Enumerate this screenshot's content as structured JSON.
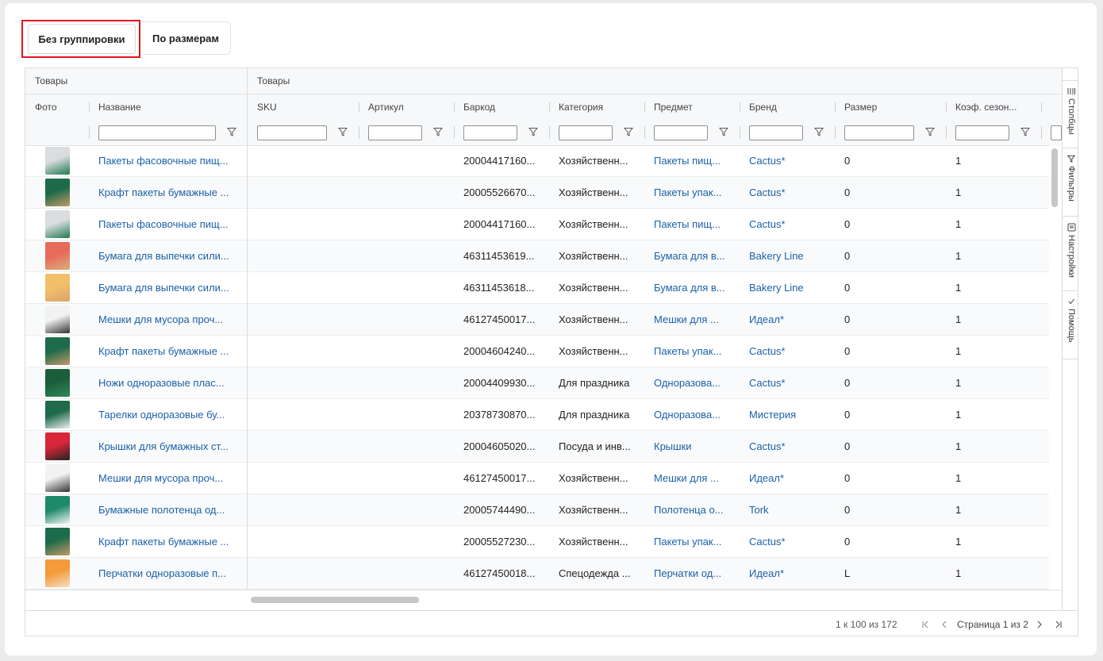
{
  "tabs": [
    {
      "label": "Без группировки"
    },
    {
      "label": "По размерам"
    }
  ],
  "header_groups": [
    {
      "label": "Товары"
    },
    {
      "label": "Товары"
    }
  ],
  "columns": [
    {
      "label": "Фото"
    },
    {
      "label": "Название"
    },
    {
      "label": "SKU"
    },
    {
      "label": "Артикул"
    },
    {
      "label": "Баркод"
    },
    {
      "label": "Категория"
    },
    {
      "label": "Предмет"
    },
    {
      "label": "Бренд"
    },
    {
      "label": "Размер"
    },
    {
      "label": "Коэф. сезон..."
    }
  ],
  "rows": [
    {
      "name": "Пакеты фасовочные пищ...",
      "barcode": "20004417160...",
      "category": "Хозяйственн...",
      "subject": "Пакеты пищ...",
      "brand": "Cactus*",
      "size": "0",
      "coef": "1",
      "thumb_colors": [
        "#d9dde0",
        "#1f7a4e"
      ]
    },
    {
      "name": "Крафт пакеты бумажные ...",
      "barcode": "20005526670...",
      "category": "Хозяйственн...",
      "subject": "Пакеты упак...",
      "brand": "Cactus*",
      "size": "0",
      "coef": "1",
      "thumb_colors": [
        "#1d6b4a",
        "#c39a6a"
      ]
    },
    {
      "name": "Пакеты фасовочные пищ...",
      "barcode": "20004417160...",
      "category": "Хозяйственн...",
      "subject": "Пакеты пищ...",
      "brand": "Cactus*",
      "size": "0",
      "coef": "1",
      "thumb_colors": [
        "#d9dde0",
        "#1f7a4e"
      ]
    },
    {
      "name": "Бумага для выпечки сили...",
      "barcode": "46311453619...",
      "category": "Хозяйственн...",
      "subject": "Бумага для в...",
      "brand": "Bakery Line",
      "size": "0",
      "coef": "1",
      "thumb_colors": [
        "#e86a5a",
        "#d9b07a"
      ]
    },
    {
      "name": "Бумага для выпечки сили...",
      "barcode": "46311453618...",
      "category": "Хозяйственн...",
      "subject": "Бумага для в...",
      "brand": "Bakery Line",
      "size": "0",
      "coef": "1",
      "thumb_colors": [
        "#f3c06a",
        "#d9a36a"
      ]
    },
    {
      "name": "Мешки для мусора проч...",
      "barcode": "46127450017...",
      "category": "Хозяйственн...",
      "subject": "Мешки для ...",
      "brand": "Идеал*",
      "size": "0",
      "coef": "1",
      "thumb_colors": [
        "#f2f2f2",
        "#333333"
      ]
    },
    {
      "name": "Крафт пакеты бумажные ...",
      "barcode": "20004604240...",
      "category": "Хозяйственн...",
      "subject": "Пакеты упак...",
      "brand": "Cactus*",
      "size": "0",
      "coef": "1",
      "thumb_colors": [
        "#1d6b4a",
        "#c39a6a"
      ]
    },
    {
      "name": "Ножи одноразовые плас...",
      "barcode": "20004409930...",
      "category": "Для праздника",
      "subject": "Одноразова...",
      "brand": "Cactus*",
      "size": "0",
      "coef": "1",
      "thumb_colors": [
        "#1b5e3c",
        "#2f8a57"
      ]
    },
    {
      "name": "Тарелки одноразовые бу...",
      "barcode": "20378730870...",
      "category": "Для праздника",
      "subject": "Одноразова...",
      "brand": "Мистерия",
      "size": "0",
      "coef": "1",
      "thumb_colors": [
        "#1e6a4a",
        "#f0f0f0"
      ]
    },
    {
      "name": "Крышки для бумажных ст...",
      "barcode": "20004605020...",
      "category": "Посуда и инв...",
      "subject": "Крышки",
      "brand": "Cactus*",
      "size": "0",
      "coef": "1",
      "thumb_colors": [
        "#d8263a",
        "#222222"
      ]
    },
    {
      "name": "Мешки для мусора проч...",
      "barcode": "46127450017...",
      "category": "Хозяйственн...",
      "subject": "Мешки для ...",
      "brand": "Идеал*",
      "size": "0",
      "coef": "1",
      "thumb_colors": [
        "#f2f2f2",
        "#333333"
      ]
    },
    {
      "name": "Бумажные полотенца од...",
      "barcode": "20005744490...",
      "category": "Хозяйственн...",
      "subject": "Полотенца о...",
      "brand": "Tork",
      "size": "0",
      "coef": "1",
      "thumb_colors": [
        "#1e8a6a",
        "#f4f4f4"
      ]
    },
    {
      "name": "Крафт пакеты бумажные ...",
      "barcode": "20005527230...",
      "category": "Хозяйственн...",
      "subject": "Пакеты упак...",
      "brand": "Cactus*",
      "size": "0",
      "coef": "1",
      "thumb_colors": [
        "#1d6b4a",
        "#c39a6a"
      ]
    },
    {
      "name": "Перчатки одноразовые п...",
      "barcode": "46127450018...",
      "category": "Спецодежда ...",
      "subject": "Перчатки од...",
      "brand": "Идеал*",
      "size": "L",
      "coef": "1",
      "thumb_colors": [
        "#f39a3a",
        "#f6e0c0"
      ]
    },
    {
      "name": "",
      "barcode": "",
      "category": "",
      "subject": "",
      "brand": "",
      "size": "",
      "coef": "",
      "thumb_colors": [
        "#e05a3a",
        "#f0b040"
      ]
    }
  ],
  "footer": {
    "range": "1 к 100 из 172",
    "page_text": "Страница 1 из 2"
  },
  "side_panel": [
    {
      "label": "Столбцы",
      "icon": "columns-icon"
    },
    {
      "label": "Фильтры",
      "icon": "filter-icon"
    },
    {
      "label": "Настройки",
      "icon": "settings-icon"
    },
    {
      "label": "Помощь",
      "icon": "check-icon"
    }
  ],
  "colors": {
    "link": "#1a61a8",
    "highlight": "#e0161d"
  }
}
